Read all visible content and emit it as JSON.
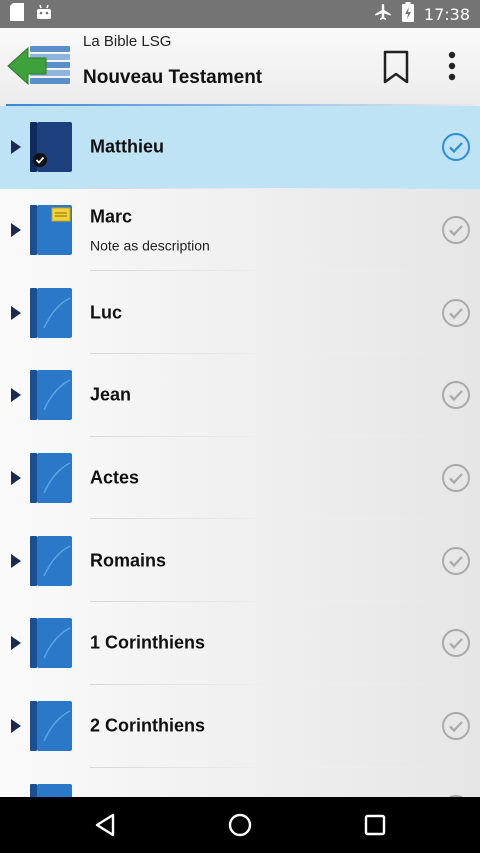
{
  "status_bar": {
    "time": "17:38"
  },
  "toolbar": {
    "subtitle": "La Bible LSG",
    "title": "Nouveau Testament"
  },
  "books": [
    {
      "title": "Matthieu",
      "description": "",
      "selected": true,
      "note": false
    },
    {
      "title": "Marc",
      "description": "Note as description",
      "selected": false,
      "note": true
    },
    {
      "title": "Luc",
      "description": "",
      "selected": false,
      "note": false
    },
    {
      "title": "Jean",
      "description": "",
      "selected": false,
      "note": false
    },
    {
      "title": "Actes",
      "description": "",
      "selected": false,
      "note": false
    },
    {
      "title": "Romains",
      "description": "",
      "selected": false,
      "note": false
    },
    {
      "title": "1 Corinthiens",
      "description": "",
      "selected": false,
      "note": false
    },
    {
      "title": "2 Corinthiens",
      "description": "",
      "selected": false,
      "note": false
    },
    {
      "title": "",
      "description": "",
      "selected": false,
      "note": false
    }
  ],
  "colors": {
    "accent": "#2f8fd8",
    "selected_bg": "#bde3f5",
    "book_blue": "#2b78c8"
  }
}
